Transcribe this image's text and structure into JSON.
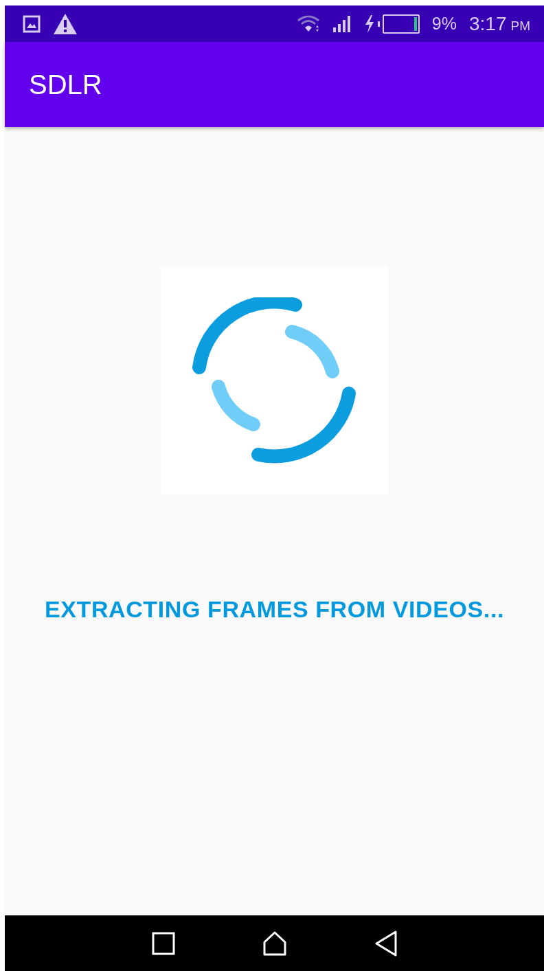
{
  "status_bar": {
    "battery": {
      "level": 0.09,
      "charging": true
    },
    "battery_text": "9%",
    "time": "3:17",
    "meridiem": "PM"
  },
  "app_bar": {
    "title": "SDLR"
  },
  "loader": {
    "message": "EXTRACTING FRAMES FROM VIDEOS..."
  }
}
